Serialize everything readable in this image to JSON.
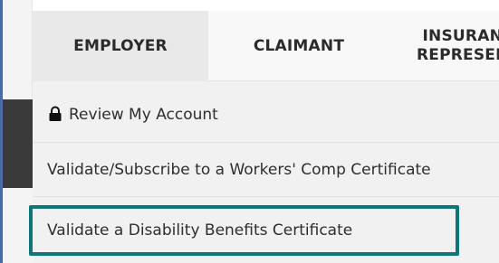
{
  "tabs": [
    {
      "label": "EMPLOYER",
      "selected": true
    },
    {
      "label": "CLAIMANT",
      "selected": false
    },
    {
      "label_line1": "INSURAN",
      "label_line2": "REPRESEN",
      "selected": false
    }
  ],
  "menu": {
    "items": [
      {
        "label": "Review My Account",
        "icon": "lock-icon"
      },
      {
        "label": "Validate/Subscribe to a Workers' Comp Certificate"
      },
      {
        "label": "Validate a Disability Benefits Certificate",
        "highlighted": true
      }
    ]
  },
  "colors": {
    "highlight": "#0f7677",
    "tab_selected_bg": "#e9e9e9",
    "menu_bg": "#f1f1f1"
  }
}
